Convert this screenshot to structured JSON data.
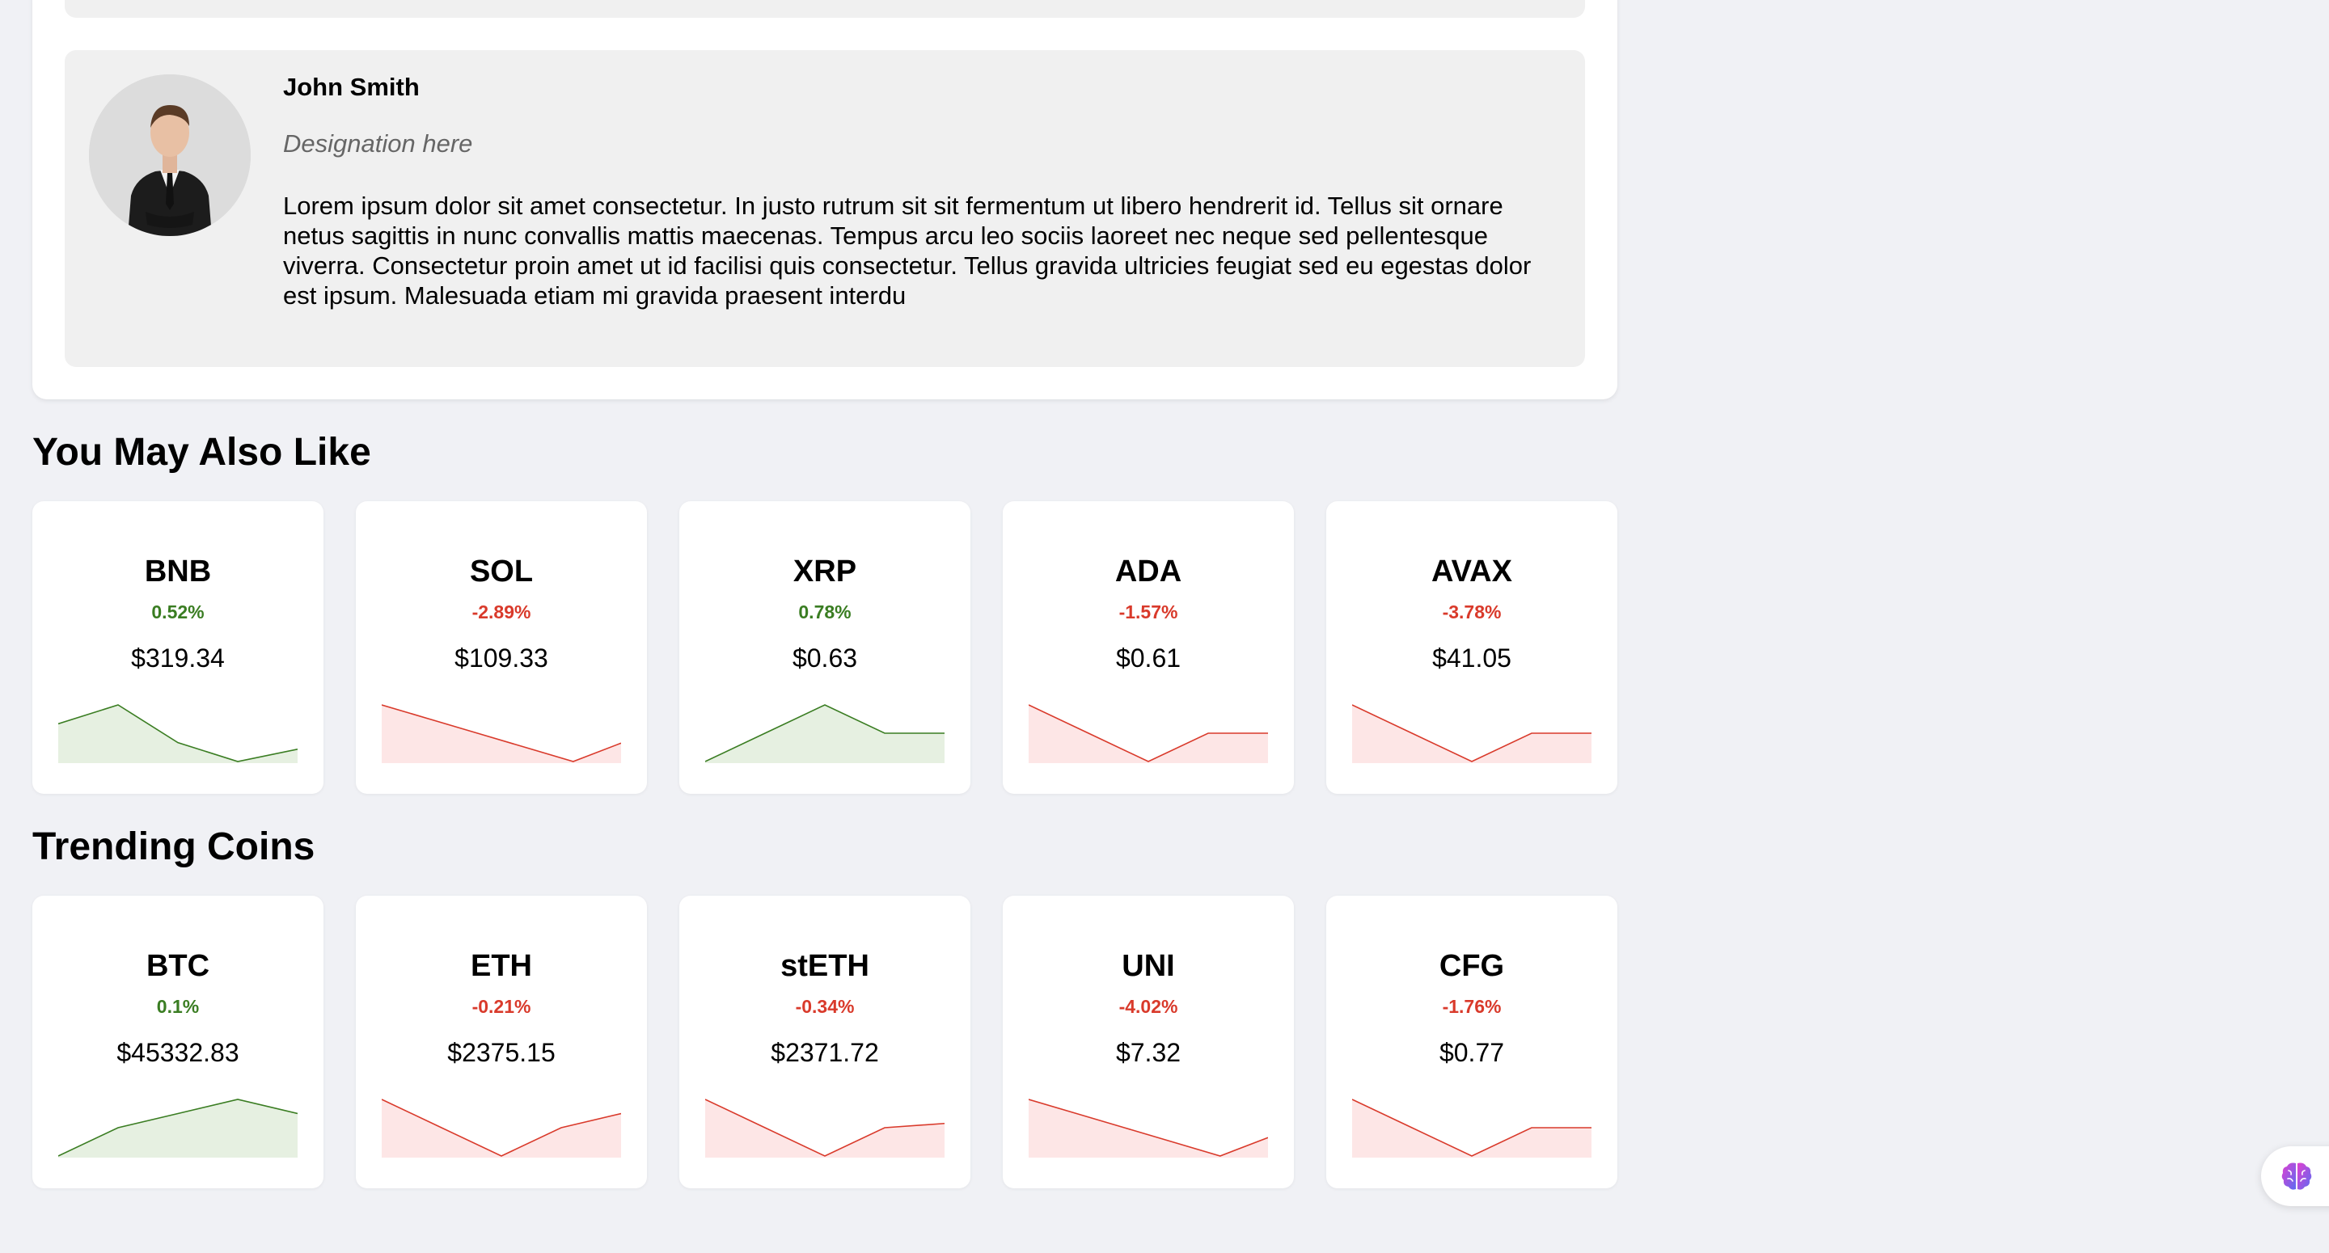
{
  "author": {
    "name": "John Smith",
    "designation": "Designation here",
    "bio": "Lorem ipsum dolor sit amet consectetur. In justo rutrum sit sit fermentum ut libero hendrerit id. Tellus sit ornare netus sagittis in nunc convallis mattis maecenas. Tempus arcu leo sociis laoreet nec neque sed pellentesque viverra. Consectetur proin amet ut id facilisi quis consectetur. Tellus gravida ultricies feugiat sed eu egestas dolor est ipsum. Malesuada etiam mi gravida praesent interdu",
    "avatar_icon": "person-in-suit-avatar"
  },
  "colors": {
    "up": "#3a7d22",
    "up_fill": "#e6f0e1",
    "down": "#d93a2b",
    "down_fill": "#fde6e6"
  },
  "sections": [
    {
      "title": "You May Also Like",
      "coins": [
        {
          "symbol": "BNB",
          "change": "0.52%",
          "direction": "up",
          "price": "$319.34",
          "spark": [
            2,
            3,
            1,
            0,
            0.65
          ]
        },
        {
          "symbol": "SOL",
          "change": "-2.89%",
          "direction": "down",
          "price": "$109.33",
          "spark": [
            4,
            3,
            2,
            1,
            0,
            1.3
          ]
        },
        {
          "symbol": "XRP",
          "change": "0.78%",
          "direction": "up",
          "price": "$0.63",
          "spark": [
            0,
            1,
            2,
            1,
            1
          ]
        },
        {
          "symbol": "ADA",
          "change": "-1.57%",
          "direction": "down",
          "price": "$0.61",
          "spark": [
            2,
            1,
            0,
            1,
            1
          ]
        },
        {
          "symbol": "AVAX",
          "change": "-3.78%",
          "direction": "down",
          "price": "$41.05",
          "spark": [
            2,
            1,
            0,
            1,
            1
          ]
        }
      ]
    },
    {
      "title": "Trending Coins",
      "coins": [
        {
          "symbol": "BTC",
          "change": "0.1%",
          "direction": "up",
          "price": "$45332.83",
          "spark": [
            0,
            1,
            1.5,
            2,
            1.5
          ]
        },
        {
          "symbol": "ETH",
          "change": "-0.21%",
          "direction": "down",
          "price": "$2375.15",
          "spark": [
            2,
            1,
            0,
            1,
            1.5
          ]
        },
        {
          "symbol": "stETH",
          "change": "-0.34%",
          "direction": "down",
          "price": "$2371.72",
          "spark": [
            2,
            1,
            0,
            1,
            1.15
          ]
        },
        {
          "symbol": "UNI",
          "change": "-4.02%",
          "direction": "down",
          "price": "$7.32",
          "spark": [
            2,
            1.5,
            1,
            0.5,
            0,
            0.65
          ]
        },
        {
          "symbol": "CFG",
          "change": "-1.76%",
          "direction": "down",
          "price": "$0.77",
          "spark": [
            2,
            1,
            0,
            1,
            1
          ]
        }
      ]
    }
  ],
  "floating_button": {
    "icon": "brain-icon"
  }
}
